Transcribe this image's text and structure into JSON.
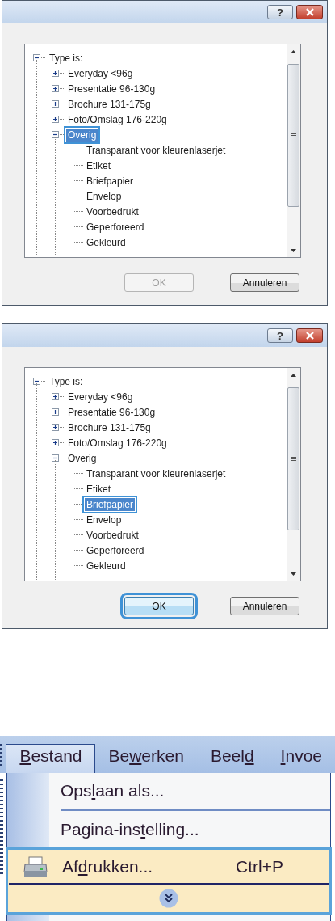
{
  "dialogs": [
    {
      "help_button": "?",
      "tree": {
        "label": "Type is:",
        "expanded": true,
        "selected": false,
        "children": [
          {
            "label": "Everyday <96g",
            "expanded": false,
            "selected": false
          },
          {
            "label": "Presentatie 96-130g",
            "expanded": false,
            "selected": false
          },
          {
            "label": "Brochure 131-175g",
            "expanded": false,
            "selected": false
          },
          {
            "label": "Foto/Omslag 176-220g",
            "expanded": false,
            "selected": false
          },
          {
            "label": "Overig",
            "expanded": true,
            "selected": true,
            "children": [
              {
                "label": "Transparant voor kleurenlaserjet",
                "selected": false
              },
              {
                "label": "Etiket",
                "selected": false
              },
              {
                "label": "Briefpapier",
                "selected": false
              },
              {
                "label": "Envelop",
                "selected": false
              },
              {
                "label": "Voorbedrukt",
                "selected": false
              },
              {
                "label": "Geperforeerd",
                "selected": false
              },
              {
                "label": "Gekleurd",
                "selected": false
              }
            ]
          }
        ]
      },
      "buttons": [
        {
          "label": "OK",
          "disabled": true,
          "focused": false
        },
        {
          "label": "Annuleren",
          "disabled": false,
          "focused": false
        }
      ]
    },
    {
      "help_button": "?",
      "tree": {
        "label": "Type is:",
        "expanded": true,
        "selected": false,
        "children": [
          {
            "label": "Everyday <96g",
            "expanded": false,
            "selected": false
          },
          {
            "label": "Presentatie 96-130g",
            "expanded": false,
            "selected": false
          },
          {
            "label": "Brochure 131-175g",
            "expanded": false,
            "selected": false
          },
          {
            "label": "Foto/Omslag 176-220g",
            "expanded": false,
            "selected": false
          },
          {
            "label": "Overig",
            "expanded": true,
            "selected": false,
            "children": [
              {
                "label": "Transparant voor kleurenlaserjet",
                "selected": false
              },
              {
                "label": "Etiket",
                "selected": false
              },
              {
                "label": "Briefpapier",
                "selected": true
              },
              {
                "label": "Envelop",
                "selected": false
              },
              {
                "label": "Voorbedrukt",
                "selected": false
              },
              {
                "label": "Geperforeerd",
                "selected": false
              },
              {
                "label": "Gekleurd",
                "selected": false
              }
            ]
          }
        ]
      },
      "buttons": [
        {
          "label": "OK",
          "disabled": false,
          "focused": true
        },
        {
          "label": "Annuleren",
          "disabled": false,
          "focused": false
        }
      ]
    }
  ],
  "menu_bar": [
    {
      "access_key": "B",
      "text_after": "estand",
      "selected": true
    },
    {
      "text_before": "Be",
      "access_key": "w",
      "text_after": "erken",
      "selected": false
    },
    {
      "text_before": "Beel",
      "access_key": "d",
      "selected": false
    },
    {
      "access_key": "I",
      "text_after": "nvoe",
      "selected": false
    }
  ],
  "menu": [
    {
      "kind": "item",
      "text_before": "Ops",
      "access_key": "l",
      "text_after": "aan als...",
      "highlighted": false
    },
    {
      "kind": "separator"
    },
    {
      "kind": "item",
      "text_before": "Pagina-ins",
      "access_key": "t",
      "text_after": "elling...",
      "highlighted": false
    },
    {
      "kind": "item",
      "icon": true,
      "text_before": "Af",
      "access_key": "d",
      "text_after": "rukken...",
      "shortcut": "Ctrl+P",
      "highlighted": true
    },
    {
      "kind": "expand",
      "highlighted": true
    }
  ]
}
